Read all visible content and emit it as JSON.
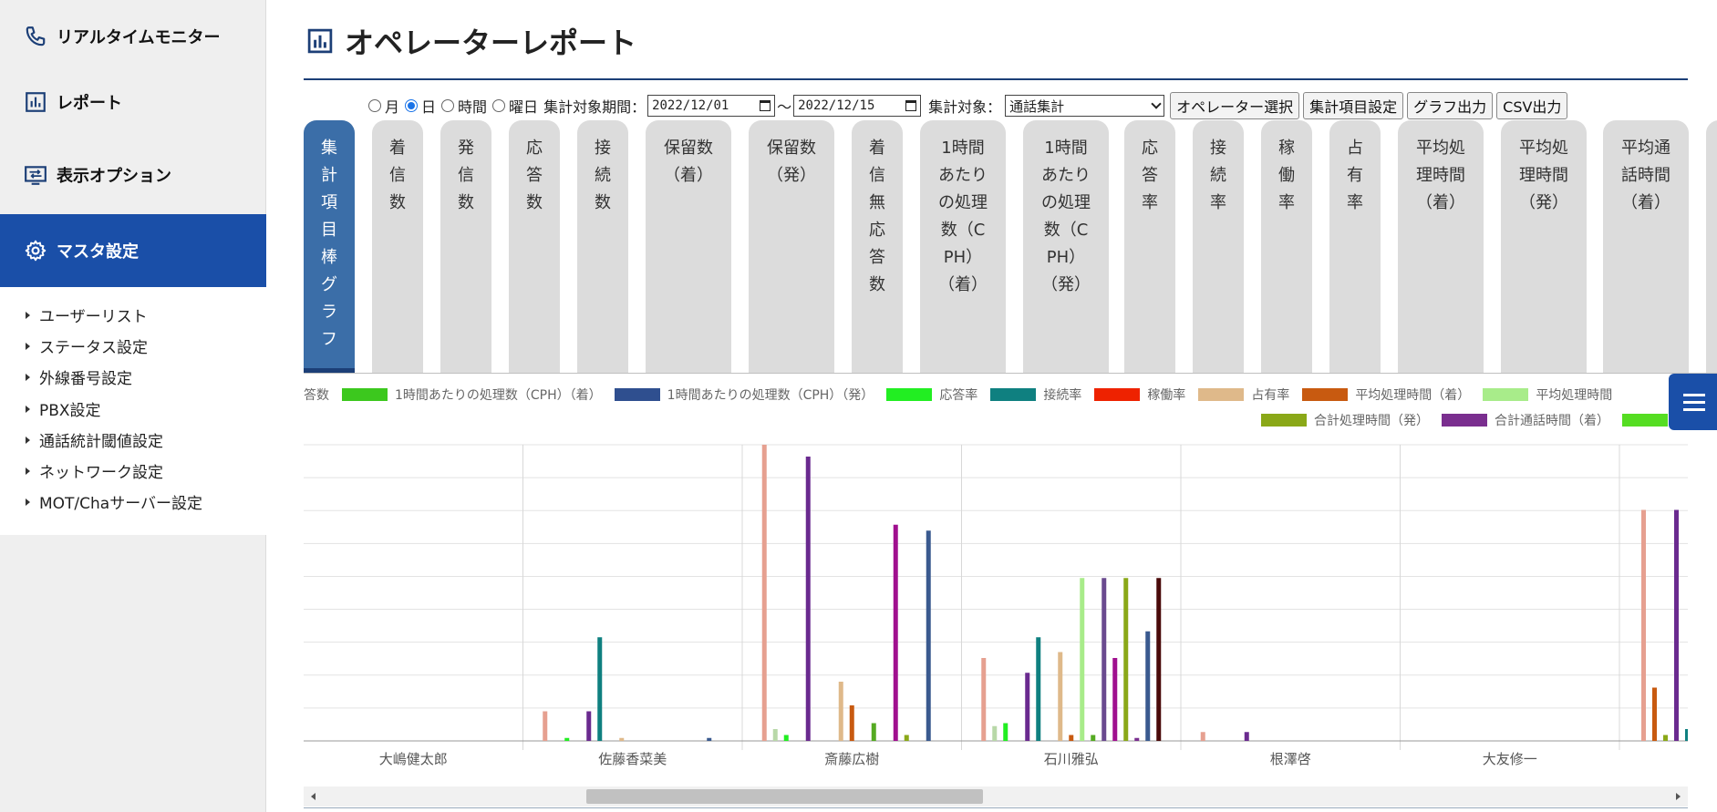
{
  "sidebar": {
    "items": [
      {
        "label": "リアルタイムモニター",
        "icon": "phone-icon"
      },
      {
        "label": "レポート",
        "icon": "report-icon"
      },
      {
        "label": "表示オプション",
        "icon": "display-options-icon"
      },
      {
        "label": "マスタ設定",
        "icon": "gear-icon"
      }
    ],
    "submenu": [
      "ユーザーリスト",
      "ステータス設定",
      "外線番号設定",
      "PBX設定",
      "通話統計閾値設定",
      "ネットワーク設定",
      "MOT/Chaサーバー設定"
    ],
    "colors": {
      "active_bg": "#1a4fa8",
      "bg": "#efefef"
    }
  },
  "header": {
    "title": "オペレーターレポート"
  },
  "controls": {
    "radio_month": "月",
    "radio_day": "日",
    "radio_hour": "時間",
    "radio_weekday": "曜日",
    "selected_radio": "日",
    "period_label": "集計対象期間：",
    "date_from": "2022/12/01",
    "tilde": "～",
    "date_to": "2022/12/15",
    "target_label": "集計対象：",
    "target_value": "通話集計",
    "btn_operator": "オペレーター選択",
    "btn_items": "集計項目設定",
    "btn_graph": "グラフ出力",
    "btn_csv": "CSV出力"
  },
  "tabs": [
    "集\n計\n項\n目\n棒\nグ\nラ\nフ",
    "着\n信\n数",
    "発\n信\n数",
    "応\n答\n数",
    "接\n続\n数",
    "保留数\n（着）",
    "保留数\n（発）",
    "着\n信\n無\n応\n答\n数",
    "1時間\nあたり\nの処理\n数（C\nPH）\n（着）",
    "1時間\nあたり\nの処理\n数（C\nPH）\n（発）",
    "応\n答\n率",
    "接\n続\n率",
    "稼\n働\n率",
    "占\n有\n率",
    "平均処\n理時間\n（着）",
    "平均処\n理時間\n（発）",
    "平均通\n話時間\n（着）"
  ],
  "legend": {
    "row1": [
      {
        "label": "答数",
        "color": ""
      },
      {
        "label": "1時間あたりの処理数（CPH）（着）",
        "color": "#3cc81e"
      },
      {
        "label": "1時間あたりの処理数（CPH）（発）",
        "color": "#2f4f8f"
      },
      {
        "label": "応答率",
        "color": "#22ee22"
      },
      {
        "label": "接続率",
        "color": "#0f8080"
      },
      {
        "label": "稼働率",
        "color": "#ee2200"
      },
      {
        "label": "占有率",
        "color": "#dfb98a"
      },
      {
        "label": "平均処理時間（着）",
        "color": "#c85a10"
      },
      {
        "label": "平均処理時間",
        "color": "#a8ec8a"
      }
    ],
    "row2": [
      {
        "label": "合計処理時間（発）",
        "color": "#8aa818"
      },
      {
        "label": "合計通話時間（着）",
        "color": "#7a2e8f"
      },
      {
        "label": "",
        "color": "#55dd22"
      }
    ]
  },
  "chart_data": {
    "type": "bar",
    "categories": [
      "大嶋健太郎",
      "佐藤香菜美",
      "斎藤広樹",
      "石川雅弘",
      "根澤啓",
      "大友修一"
    ],
    "ylim": [
      0,
      100
    ],
    "grid": true,
    "series": [
      {
        "values": [
          0,
          10,
          100,
          28,
          3,
          0
        ],
        "color": "#e6a090"
      },
      {
        "values": [
          0,
          0,
          4,
          5,
          0,
          0
        ],
        "color": "#b8d8a8"
      },
      {
        "values": [
          0,
          1,
          2,
          6,
          0,
          0
        ],
        "color": "#22ee22"
      },
      {
        "values": [
          0,
          0,
          0,
          0,
          0,
          0
        ],
        "color": "#3cc81e"
      },
      {
        "values": [
          0,
          10,
          96,
          23,
          3,
          0
        ],
        "color": "#6a2a8f"
      },
      {
        "values": [
          0,
          35,
          0,
          35,
          0,
          0
        ],
        "color": "#0f8080"
      },
      {
        "values": [
          0,
          0,
          0,
          0,
          0,
          0
        ],
        "color": "#ee2200"
      },
      {
        "values": [
          0,
          1,
          20,
          30,
          0,
          0
        ],
        "color": "#dfb98a"
      },
      {
        "values": [
          0,
          0,
          12,
          2,
          0,
          0
        ],
        "color": "#c85a10"
      },
      {
        "values": [
          0,
          0,
          0,
          55,
          0,
          0
        ],
        "color": "#a8ec8a"
      },
      {
        "values": [
          0,
          0,
          6,
          2,
          0,
          0
        ],
        "color": "#55aa22"
      },
      {
        "values": [
          0,
          0,
          0,
          55,
          0,
          0
        ],
        "color": "#6a4a8f"
      },
      {
        "values": [
          0,
          0,
          73,
          28,
          0,
          0
        ],
        "color": "#a0108f"
      },
      {
        "values": [
          0,
          0,
          2,
          55,
          0,
          0
        ],
        "color": "#8aa818"
      },
      {
        "values": [
          0,
          0,
          0,
          1,
          0,
          0
        ],
        "color": "#7a2e8f"
      },
      {
        "values": [
          0,
          1,
          71,
          37,
          0,
          0
        ],
        "color": "#3a5a8f"
      },
      {
        "values": [
          0,
          0,
          0,
          55,
          0,
          0
        ],
        "color": "#4a0a0a"
      }
    ],
    "partial_right": {
      "values": [
        78,
        18,
        2,
        78,
        4
      ],
      "colors": [
        "#e6a090",
        "#c85a10",
        "#8aa818",
        "#6a2a8f",
        "#0f8080"
      ]
    }
  }
}
